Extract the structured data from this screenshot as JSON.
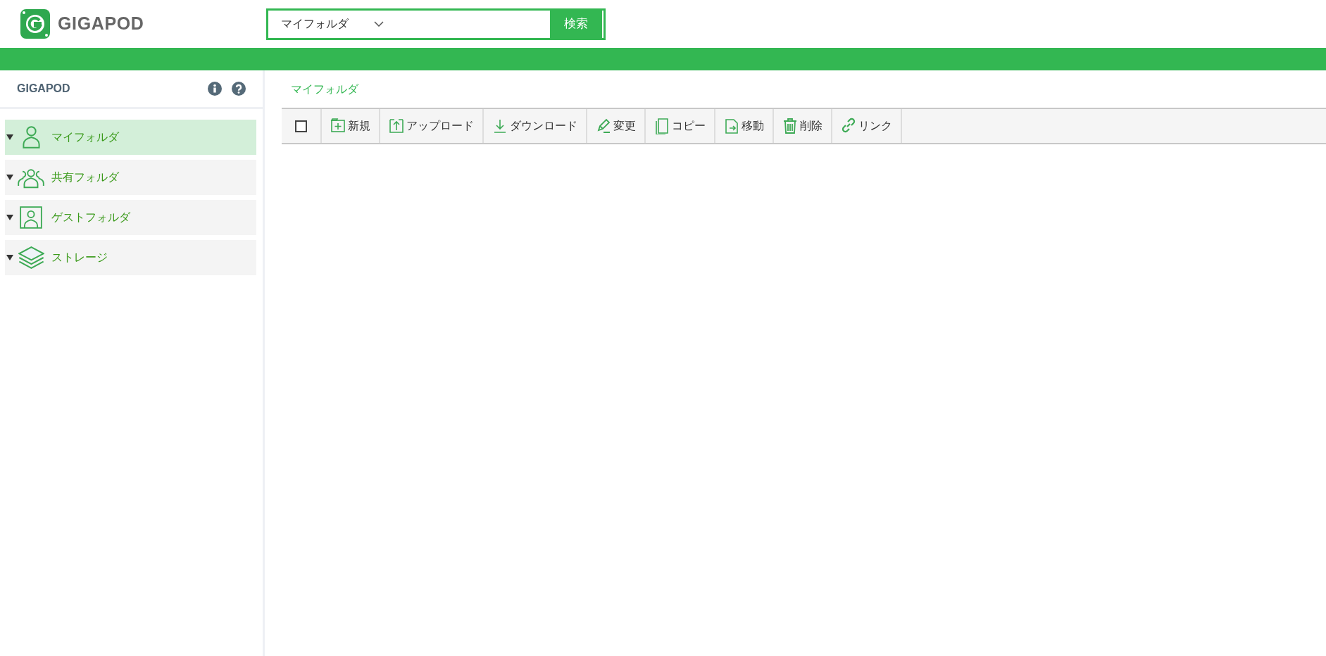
{
  "header": {
    "logo_text": "GIGAPOD",
    "search": {
      "scope": "マイフォルダ",
      "button": "検索"
    }
  },
  "sidebar": {
    "title": "GIGAPOD",
    "items": [
      {
        "kind": "user",
        "label": "マイフォルダ",
        "selected": true
      },
      {
        "kind": "group",
        "label": "共有フォルダ",
        "selected": false
      },
      {
        "kind": "guest",
        "label": "ゲストフォルダ",
        "selected": false
      },
      {
        "kind": "storage",
        "label": "ストレージ",
        "selected": false
      }
    ]
  },
  "breadcrumb": "マイフォルダ",
  "toolbar": {
    "select_all_checked": false,
    "buttons": [
      {
        "kind": "new",
        "label": "新規"
      },
      {
        "kind": "upload",
        "label": "アップロード"
      },
      {
        "kind": "download",
        "label": "ダウンロード"
      },
      {
        "kind": "edit",
        "label": "変更"
      },
      {
        "kind": "copy",
        "label": "コピー"
      },
      {
        "kind": "move",
        "label": "移動"
      },
      {
        "kind": "delete",
        "label": "削除"
      },
      {
        "kind": "link",
        "label": "リンク"
      }
    ]
  }
}
